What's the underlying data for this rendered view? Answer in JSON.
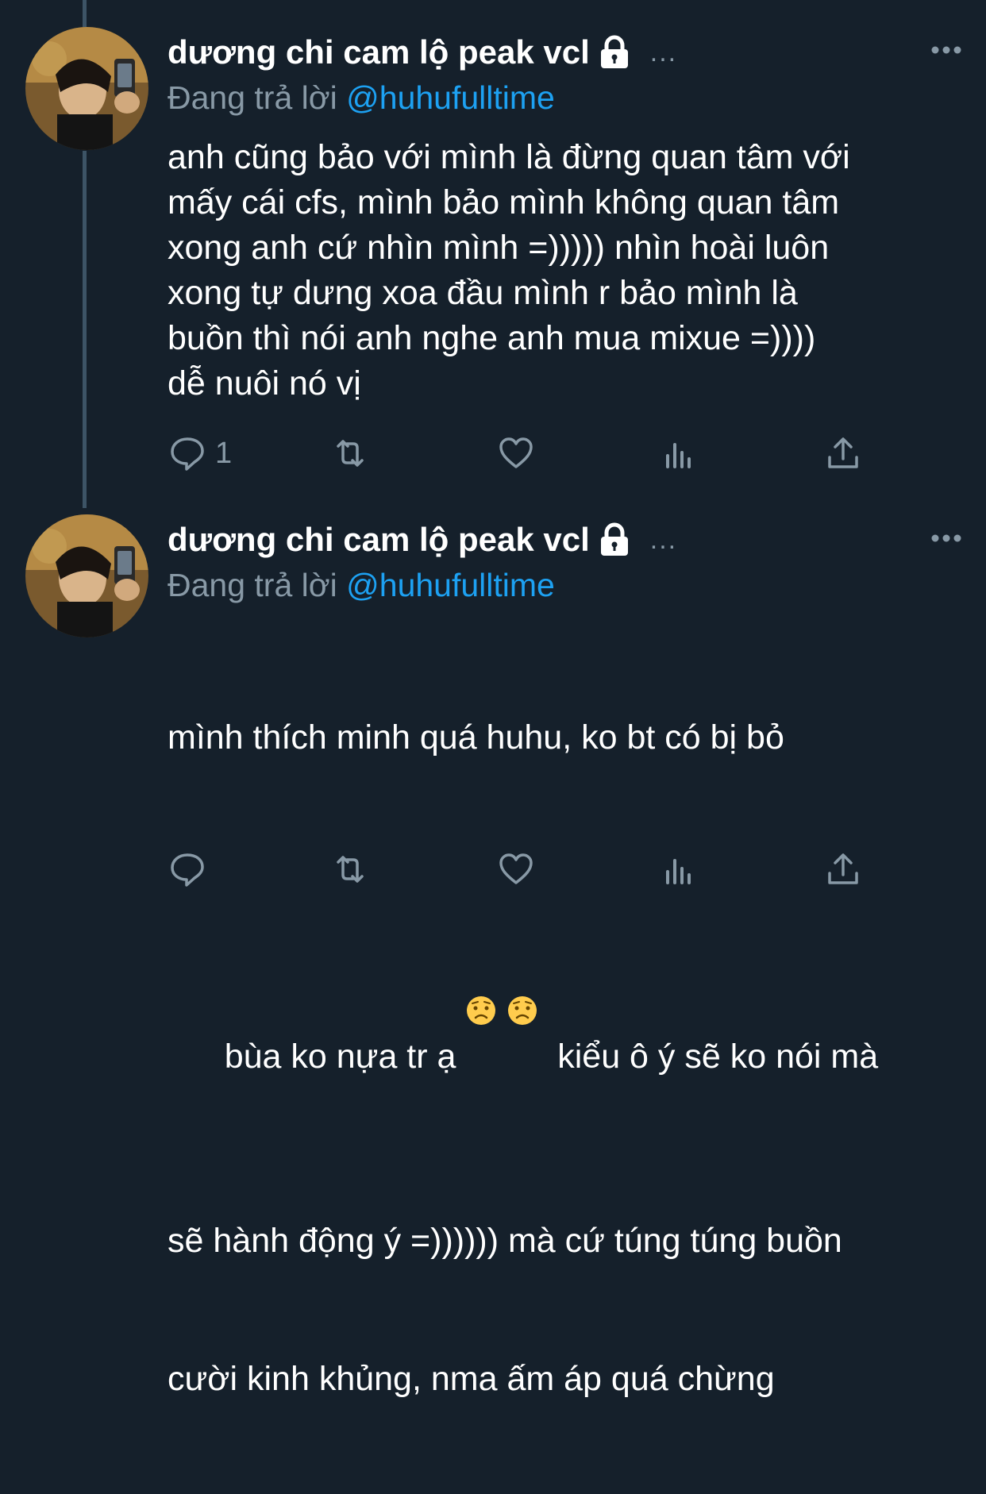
{
  "tweets": [
    {
      "display_name": "dương chi cam lộ peak vcl",
      "dots": "...",
      "replying_prefix": "Đang trả lời",
      "replying_handle": "@huhufulltime",
      "text": "anh cũng bảo với mình là đừng quan tâm với\nmấy cái cfs, mình bảo mình không quan tâm\nxong anh cứ nhìn mình =))))) nhìn hoài luôn\nxong tự dưng xoa đầu mình r bảo mình là\nbuồn thì nói anh nghe anh mua mixue =))))\ndễ nuôi nó vị",
      "reply_count": "1"
    },
    {
      "display_name": "dương chi cam lộ peak vcl",
      "dots": "...",
      "replying_prefix": "Đang trả lời",
      "replying_handle": "@huhufulltime",
      "text_line1": "mình thích minh quá huhu, ko bt có bị bỏ",
      "text_line2a": "bùa ko nựa tr ạ ",
      "text_line2b": "  kiểu ô ý sẽ ko nói mà",
      "text_line3": "sẽ hành động ý =)))))) mà cứ túng túng buồn",
      "text_line4": "cười kinh khủng, nma ấm áp quá chừng",
      "emoji": "worried-face",
      "reply_count": ""
    }
  ],
  "colors": {
    "background": "#15202b",
    "secondary_text": "#8899a6",
    "link": "#1da1f2",
    "thread_line": "#3d5466"
  },
  "icons": [
    "lock-icon",
    "more-icon",
    "reply-icon",
    "retweet-icon",
    "like-icon",
    "analytics-icon",
    "share-icon"
  ]
}
